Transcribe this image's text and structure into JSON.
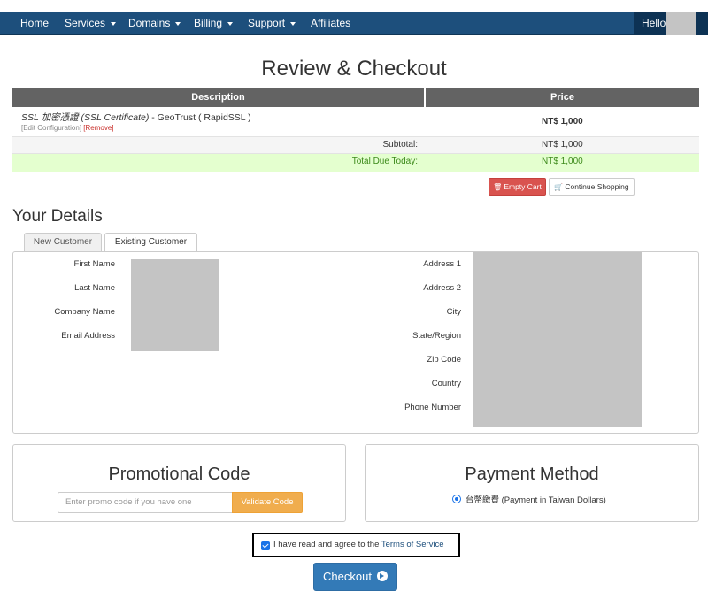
{
  "nav": {
    "items": [
      {
        "label": "Home",
        "dropdown": false
      },
      {
        "label": "Services",
        "dropdown": true
      },
      {
        "label": "Domains",
        "dropdown": true
      },
      {
        "label": "Billing",
        "dropdown": true
      },
      {
        "label": "Support",
        "dropdown": true
      },
      {
        "label": "Affiliates",
        "dropdown": false
      }
    ],
    "greeting": "Hello,"
  },
  "page_title": "Review & Checkout",
  "cart": {
    "columns": [
      "Description",
      "Price"
    ],
    "item": {
      "name": "SSL 加密憑證 (SSL Certificate)",
      "product": " - GeoTrust ( RapidSSL )",
      "edit_link": "[Edit Configuration]",
      "remove_link": "[Remove]",
      "price": "NT$ 1,000"
    },
    "subtotal_label": "Subtotal:",
    "subtotal_value": "NT$ 1,000",
    "total_label": "Total Due Today:",
    "total_value": "NT$ 1,000",
    "empty_cart": "Empty Cart",
    "continue_shopping": "Continue Shopping"
  },
  "details": {
    "title": "Your Details",
    "tabs": [
      "New Customer",
      "Existing Customer"
    ],
    "active_tab": "Existing Customer",
    "left_fields": [
      "First Name",
      "Last Name",
      "Company Name",
      "Email Address"
    ],
    "right_fields": [
      "Address 1",
      "Address 2",
      "City",
      "State/Region",
      "Zip Code",
      "Country",
      "Phone Number"
    ]
  },
  "promo": {
    "title": "Promotional Code",
    "placeholder": "Enter promo code if you have one",
    "button": "Validate Code"
  },
  "payment": {
    "title": "Payment Method",
    "option": "台幣繳費 (Payment in Taiwan Dollars)",
    "selected": true
  },
  "agree": {
    "text": "I have read and agree to the ",
    "link": "Terms of Service",
    "checked": true
  },
  "checkout_button": "Checkout",
  "colors": {
    "nav_bg": "#1d4f7c",
    "header_bg": "#636363",
    "total_bg": "#e4ffcf",
    "danger": "#d9534f",
    "warning": "#f0ad4e",
    "primary": "#337ab7"
  },
  "icons": {
    "empty_cart": "trash-icon",
    "continue_shopping": "cart-icon",
    "checkout": "arrow-circle-right-icon"
  }
}
